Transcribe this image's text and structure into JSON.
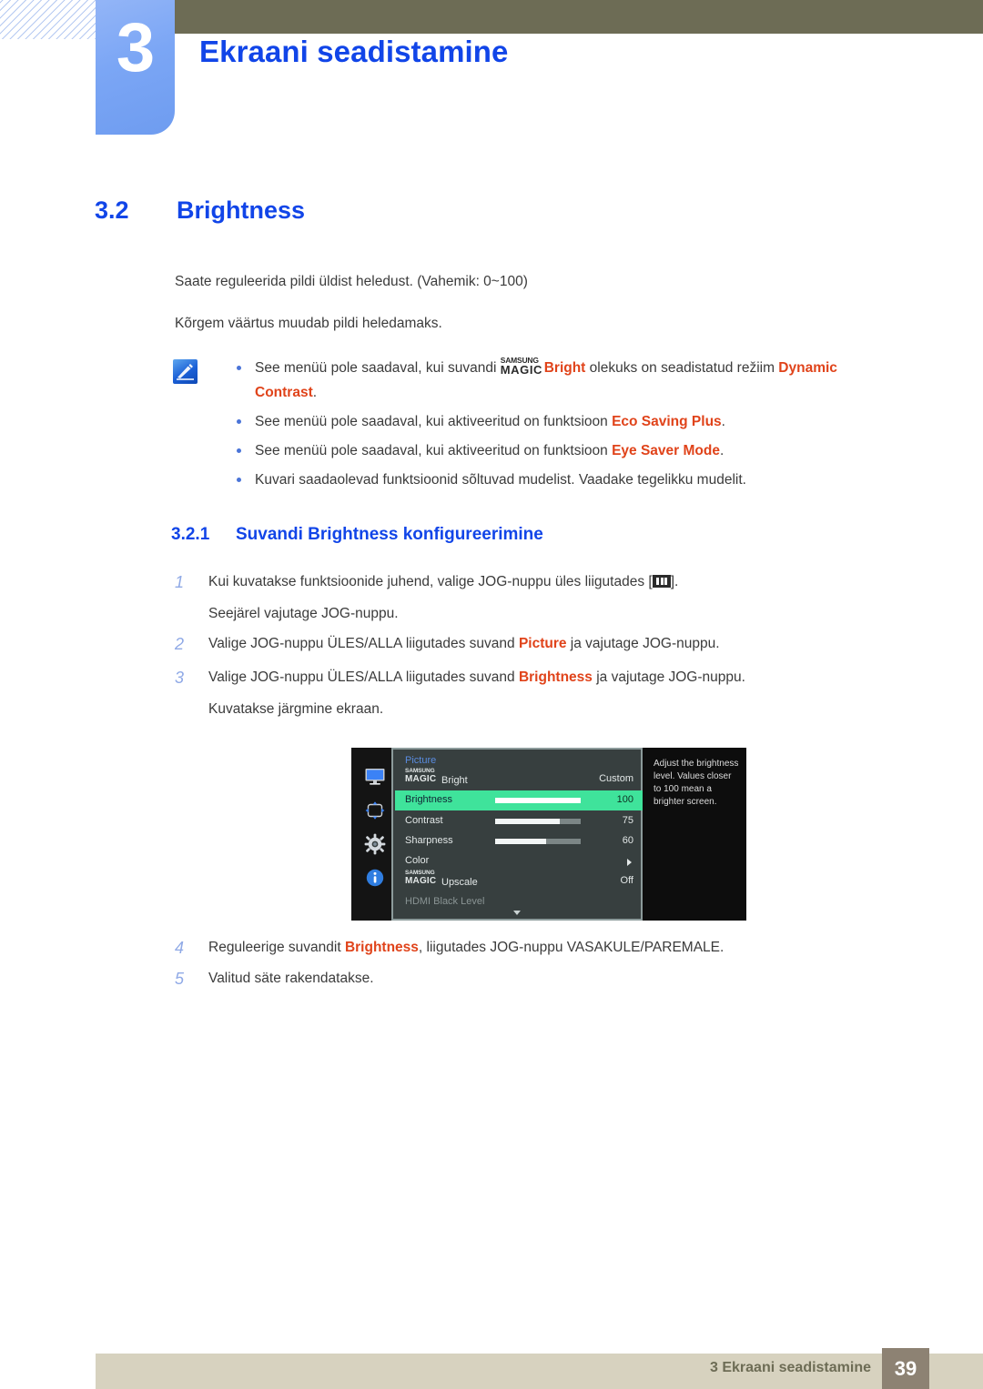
{
  "chapter": {
    "number": "3",
    "title": "Ekraani seadistamine"
  },
  "section": {
    "number": "3.2",
    "title": "Brightness"
  },
  "intro": {
    "paragraph1": "Saate reguleerida pildi üldist heledust. (Vahemik: 0~100)",
    "paragraph2": "Kõrgem väärtus muudab pildi heledamaks."
  },
  "note": {
    "icon": "note-pen-icon",
    "items": [
      {
        "pre": "See menüü pole saadaval, kui suvandi ",
        "magic_sup": "SAMSUNG",
        "magic_main": "MAGIC",
        "magic_tail": "Bright",
        "mid": " olekuks on seadistatud režiim ",
        "highlight": "Dynamic Contrast",
        "post": "."
      },
      {
        "pre": "See menüü pole saadaval, kui aktiveeritud on funktsioon ",
        "highlight": "Eco Saving Plus",
        "post": "."
      },
      {
        "pre": "See menüü pole saadaval, kui aktiveeritud on funktsioon ",
        "highlight": "Eye Saver Mode",
        "post": "."
      },
      {
        "pre": "Kuvari saadaolevad funktsioonid sõltuvad mudelist. Vaadake tegelikku mudelit.",
        "highlight": "",
        "post": ""
      }
    ]
  },
  "subsection": {
    "number": "3.2.1",
    "title": "Suvandi Brightness konfigureerimine"
  },
  "steps": [
    {
      "num": "1",
      "pre": "Kui kuvatakse funktsioonide juhend, valige JOG-nuppu üles liigutades [",
      "glyph": "jog-up-icon",
      "post": "].",
      "sub": "Seejärel vajutage JOG-nuppu."
    },
    {
      "num": "2",
      "pre": "Valige JOG-nuppu ÜLES/ALLA liigutades suvand ",
      "highlight": "Picture",
      "post": " ja vajutage JOG-nuppu.",
      "sub": ""
    },
    {
      "num": "3",
      "pre": "Valige JOG-nuppu ÜLES/ALLA liigutades suvand ",
      "highlight": "Brightness",
      "post": " ja vajutage JOG-nuppu.",
      "sub": "Kuvatakse järgmine ekraan."
    },
    {
      "num": "4",
      "pre": "Reguleerige suvandit ",
      "highlight": "Brightness",
      "post": ", liigutades JOG-nuppu VASAKULE/PAREMALE.",
      "sub": ""
    },
    {
      "num": "5",
      "pre": "Valitud säte rakendatakse.",
      "highlight": "",
      "post": "",
      "sub": ""
    }
  ],
  "osd": {
    "title": "Picture",
    "rail_icons": [
      "monitor-icon",
      "screen-adjust-icon",
      "gear-icon",
      "info-icon"
    ],
    "rows": [
      {
        "id": "magicbright",
        "magic_sup": "SAMSUNG",
        "magic_main": "MAGIC",
        "label": "Bright",
        "value": "Custom",
        "selected": false,
        "bar": null
      },
      {
        "id": "brightness",
        "label": "Brightness",
        "value": "100",
        "selected": true,
        "bar": 100
      },
      {
        "id": "contrast",
        "label": "Contrast",
        "value": "75",
        "selected": false,
        "bar": 75
      },
      {
        "id": "sharpness",
        "label": "Sharpness",
        "value": "60",
        "selected": false,
        "bar": 60
      },
      {
        "id": "color",
        "label": "Color",
        "value": "",
        "selected": false,
        "bar": null
      },
      {
        "id": "upscale",
        "magic_sup": "SAMSUNG",
        "magic_main": "MAGIC",
        "label": "Upscale",
        "value": "Off",
        "selected": false,
        "bar": null
      },
      {
        "id": "hdmi_black_level",
        "label": "HDMI Black Level",
        "value": "",
        "selected": false,
        "bar": null
      }
    ],
    "help_text": "Adjust the brightness level. Values closer to 100 mean a brighter screen."
  },
  "footer": {
    "text": "3 Ekraani seadistamine",
    "page": "39"
  },
  "colors": {
    "heading_blue": "#1145e8",
    "highlight_orange": "#e0431a",
    "olive": "#6d6c55",
    "chapter_blue": "#7ba6f5",
    "footer_bar": "#d7d2bf",
    "page_badge": "#8d8273",
    "osd_selected_green": "#3fe39b"
  }
}
